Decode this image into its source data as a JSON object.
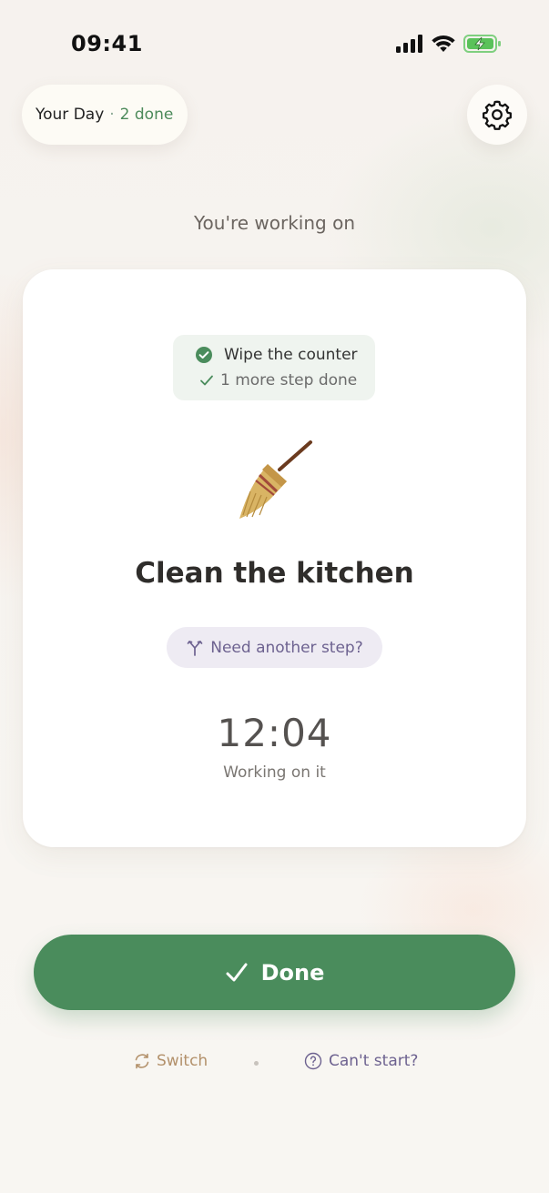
{
  "status_bar": {
    "time": "09:41"
  },
  "header": {
    "day_title": "Your Day",
    "separator": "·",
    "done_count": "2 done"
  },
  "working_label": "You're working on",
  "card": {
    "completed_step": "Wipe the counter",
    "more_steps": "1 more step done",
    "task_emoji": "broom",
    "task_title": "Clean the kitchen",
    "another_step_label": "Need another step?",
    "timer": "12:04",
    "timer_label": "Working on it"
  },
  "actions": {
    "done_label": "Done",
    "switch_label": "Switch",
    "cant_start_label": "Can't start?"
  },
  "colors": {
    "accent_green": "#4a8c5c",
    "done_count_green": "#4c8a5a",
    "switch_tan": "#b3916b",
    "purple": "#6d6290",
    "battery_green": "#5ac25a"
  }
}
